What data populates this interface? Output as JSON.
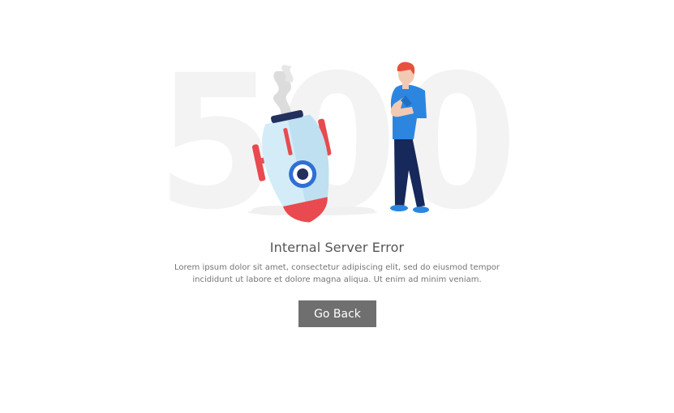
{
  "error": {
    "code": "500",
    "title": "Internal Server Error",
    "description": "Lorem ipsum dolor sit amet, consectetur adipiscing elit, sed do eiusmod tempor incididunt ut labore et dolore magna aliqua. Ut enim ad minim veniam.",
    "button_label": "Go Back"
  },
  "colors": {
    "background": "#ffffff",
    "code_watermark": "#f3f3f3",
    "button": "#6f6f6f",
    "rocket_body": "#d3ecf7",
    "rocket_accent": "#e84a4f",
    "rocket_window": "#2f6fd6",
    "shirt": "#2c86e0",
    "pants": "#17285a"
  },
  "illustration": {
    "subject": "crashed-rocket-and-thinking-man-icon"
  }
}
